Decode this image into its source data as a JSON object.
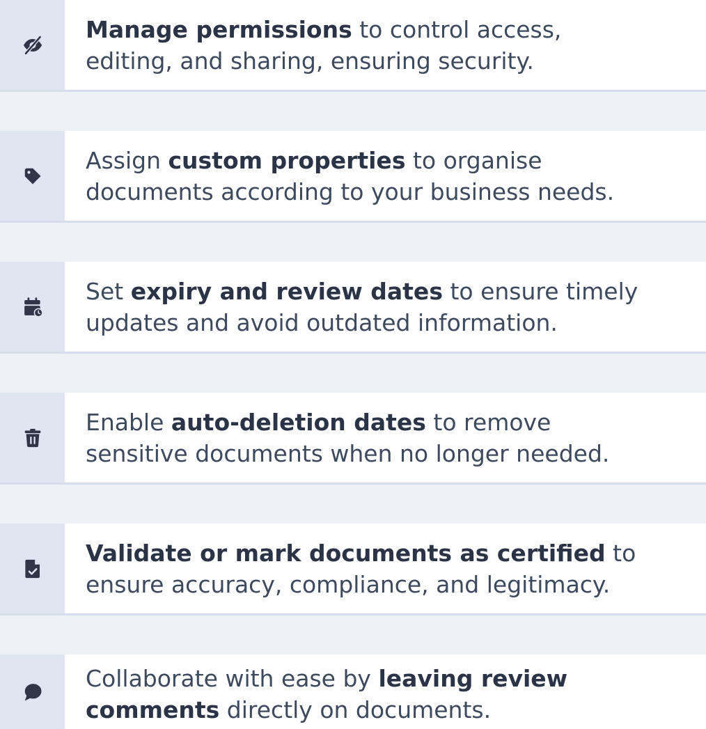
{
  "features": [
    {
      "icon": "eye-slash-icon",
      "line1": {
        "before": "",
        "bold": "Manage permissions",
        "after": " to control access,"
      },
      "line2": {
        "before": "editing, and sharing, ensuring security.",
        "bold": "",
        "after": ""
      }
    },
    {
      "icon": "tag-icon",
      "line1": {
        "before": "Assign ",
        "bold": "custom properties",
        "after": " to organise"
      },
      "line2": {
        "before": "documents according to your business needs.",
        "bold": "",
        "after": ""
      }
    },
    {
      "icon": "calendar-clock-icon",
      "line1": {
        "before": "Set ",
        "bold": "expiry and review dates",
        "after": " to ensure timely"
      },
      "line2": {
        "before": "updates and avoid outdated information.",
        "bold": "",
        "after": ""
      }
    },
    {
      "icon": "trash-icon",
      "line1": {
        "before": "Enable ",
        "bold": "auto-deletion dates",
        "after": " to remove"
      },
      "line2": {
        "before": "sensitive documents when no longer needed.",
        "bold": "",
        "after": ""
      }
    },
    {
      "icon": "file-check-icon",
      "line1": {
        "before": "",
        "bold": "Validate or mark documents as certified",
        "after": " to"
      },
      "line2": {
        "before": "ensure accuracy, compliance, and legitimacy.",
        "bold": "",
        "after": ""
      }
    },
    {
      "icon": "comment-icon",
      "line1": {
        "before": "Collaborate with ease by ",
        "bold": "leaving review",
        "after": ""
      },
      "line2": {
        "before": "",
        "bold": "comments",
        "after": " directly on documents."
      }
    }
  ],
  "colors": {
    "icon": "#2f3648",
    "icon_column": "#dfe5f1",
    "row_background": "#ffffff",
    "page_background": "#edf0f5",
    "text": "#3d4a5e",
    "text_bold": "#2b3447"
  }
}
